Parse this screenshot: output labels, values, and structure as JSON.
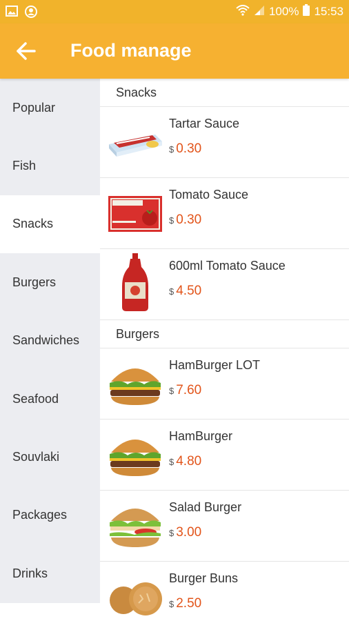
{
  "status_bar": {
    "battery": "100%",
    "time": "15:53"
  },
  "app_bar": {
    "title": "Food manage"
  },
  "sidebar": {
    "items": [
      {
        "label": "Popular"
      },
      {
        "label": "Fish"
      },
      {
        "label": "Snacks",
        "active": true
      },
      {
        "label": "Burgers"
      },
      {
        "label": "Sandwiches"
      },
      {
        "label": "Seafood"
      },
      {
        "label": "Souvlaki"
      },
      {
        "label": "Packages"
      },
      {
        "label": "Drinks"
      }
    ]
  },
  "sections": [
    {
      "title": "Snacks",
      "items": [
        {
          "name": "Tartar Sauce",
          "currency": "$",
          "price": "0.30",
          "image": "tartar-sauce-cup"
        },
        {
          "name": "Tomato Sauce",
          "currency": "$",
          "price": "0.30",
          "image": "tomato-sauce-sachet"
        },
        {
          "name": "600ml Tomato Sauce",
          "currency": "$",
          "price": "4.50",
          "image": "tomato-sauce-bottle"
        }
      ]
    },
    {
      "title": "Burgers",
      "items": [
        {
          "name": "HamBurger LOT",
          "currency": "$",
          "price": "7.60",
          "image": "hamburger"
        },
        {
          "name": "HamBurger",
          "currency": "$",
          "price": "4.80",
          "image": "hamburger"
        },
        {
          "name": "Salad Burger",
          "currency": "$",
          "price": "3.00",
          "image": "salad-burger"
        },
        {
          "name": " Burger Buns",
          "currency": "$",
          "price": "2.50",
          "image": "burger-buns"
        }
      ]
    }
  ],
  "colors": {
    "accent": "#f6b131",
    "price": "#e2541a",
    "sidebar_bg": "#ecedf1"
  }
}
